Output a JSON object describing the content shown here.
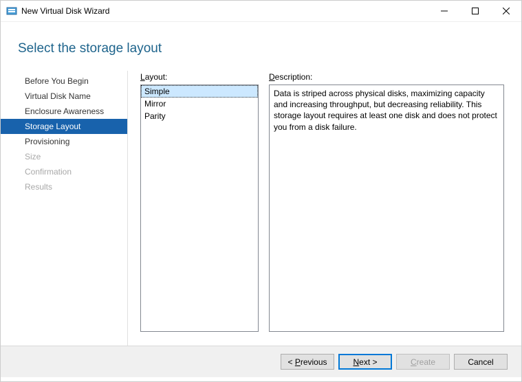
{
  "window": {
    "title": "New Virtual Disk Wizard"
  },
  "page": {
    "title": "Select the storage layout"
  },
  "sidebar": {
    "items": [
      {
        "label": "Before You Begin",
        "state": "normal"
      },
      {
        "label": "Virtual Disk Name",
        "state": "normal"
      },
      {
        "label": "Enclosure Awareness",
        "state": "normal"
      },
      {
        "label": "Storage Layout",
        "state": "active"
      },
      {
        "label": "Provisioning",
        "state": "normal"
      },
      {
        "label": "Size",
        "state": "disabled"
      },
      {
        "label": "Confirmation",
        "state": "disabled"
      },
      {
        "label": "Results",
        "state": "disabled"
      }
    ]
  },
  "layout_panel": {
    "label_prefix": "L",
    "label_rest": "ayout:",
    "items": [
      {
        "label": "Simple",
        "selected": true
      },
      {
        "label": "Mirror",
        "selected": false
      },
      {
        "label": "Parity",
        "selected": false
      }
    ]
  },
  "description_panel": {
    "label_prefix": "D",
    "label_rest": "escription:",
    "text": "Data is striped across physical disks, maximizing capacity and increasing throughput, but decreasing reliability. This storage layout requires at least one disk and does not protect you from a disk failure."
  },
  "buttons": {
    "previous": "< Previous",
    "next": "Next >",
    "create": "Create",
    "cancel": "Cancel"
  }
}
